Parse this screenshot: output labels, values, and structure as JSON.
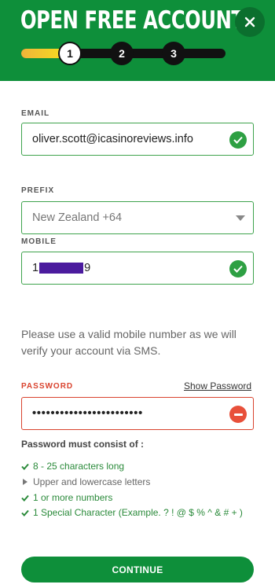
{
  "header": {
    "title": "OPEN FREE ACCOUNT",
    "close_icon": "close-icon",
    "background": "#0e8f3a"
  },
  "progress": {
    "steps": [
      "1",
      "2",
      "3"
    ],
    "current_step": 1
  },
  "email": {
    "label": "EMAIL",
    "value": "oliver.scott@icasinoreviews.info",
    "status": "valid"
  },
  "prefix": {
    "label": "PREFIX",
    "value": "New Zealand +64"
  },
  "mobile": {
    "label": "MOBILE",
    "value_start": "1",
    "value_end": "9",
    "status": "valid"
  },
  "info_text": "Please use a valid mobile number as we will verify your account via SMS.",
  "password": {
    "label": "PASSWORD",
    "show_label": "Show Password",
    "masked_value": "••••••••••••••••••••••••",
    "status": "error"
  },
  "rules": {
    "title": "Password must consist of :",
    "items": [
      {
        "text": "8 - 25 characters long",
        "met": true
      },
      {
        "text": "Upper and lowercase letters",
        "met": false
      },
      {
        "text": "1 or more numbers",
        "met": true
      },
      {
        "text": "1 Special Character (Example. ? ! @ $ % ^ & # + )",
        "met": true
      }
    ]
  },
  "continue_label": "CONTINUE"
}
